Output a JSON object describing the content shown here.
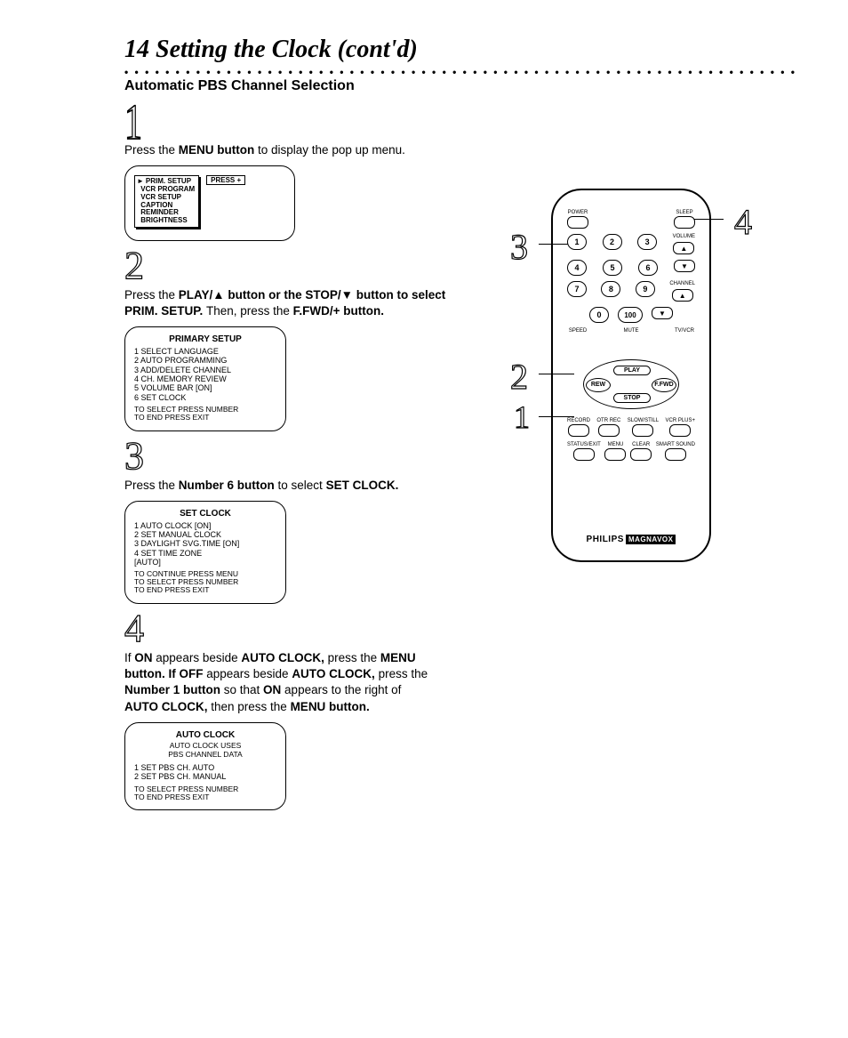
{
  "page": {
    "title": "14  Setting the Clock (cont'd)",
    "subtitle": "Automatic PBS Channel Selection"
  },
  "steps": {
    "s1": {
      "num": "1",
      "text_prefix": "Press the ",
      "bold1": "MENU button",
      "text_suffix": " to display the pop up menu."
    },
    "s2": {
      "num": "2",
      "line1_a": "Press the ",
      "line1_b": "PLAY/▲ button or the STOP/▼ button to select",
      "line2_a": "PRIM. SETUP. ",
      "line2_b": "Then, press the ",
      "line2_c": "F.FWD/+ button."
    },
    "s3": {
      "num": "3",
      "a": "Press the ",
      "b": "Number 6 button ",
      "c": "to select ",
      "d": "SET CLOCK."
    },
    "s4": {
      "num": "4",
      "l1a": "If ",
      "l1b": "ON ",
      "l1c": "appears beside ",
      "l1d": "AUTO CLOCK, ",
      "l1e": "press the ",
      "l1f": "MENU",
      "l2a": "button. If ",
      "l2b": "OFF ",
      "l2c": "appears beside ",
      "l2d": "AUTO CLOCK, ",
      "l2e": "press the",
      "l3a": "Number 1 button ",
      "l3b": "so that ",
      "l3c": "ON ",
      "l3d": "appears to the right of",
      "l4a": "AUTO CLOCK, ",
      "l4b": "then press the ",
      "l4c": "MENU button."
    }
  },
  "screens": {
    "menu1": {
      "items": [
        "PRIM. SETUP",
        "VCR PROGRAM",
        "VCR SETUP",
        "CAPTION",
        "REMINDER",
        "BRIGHTNESS"
      ],
      "button": "PRESS +"
    },
    "primary": {
      "heading": "PRIMARY SETUP",
      "items": [
        "1  SELECT LANGUAGE",
        "2  AUTO PROGRAMMING",
        "3  ADD/DELETE CHANNEL",
        "4  CH. MEMORY REVIEW",
        "5  VOLUME BAR        [ON]",
        "6  SET CLOCK"
      ],
      "foot1": "TO SELECT PRESS NUMBER",
      "foot2": "TO END PRESS EXIT"
    },
    "setclock": {
      "heading": "SET CLOCK",
      "items": [
        "1  AUTO CLOCK          [ON]",
        "2  SET MANUAL CLOCK",
        "3  DAYLIGHT SVG.TIME [ON]",
        "4  SET TIME ZONE",
        "    [AUTO]"
      ],
      "foot1": "TO CONTINUE PRESS MENU",
      "foot2": "TO SELECT PRESS NUMBER",
      "foot3": "TO END PRESS EXIT"
    },
    "autoclock": {
      "heading": "AUTO CLOCK",
      "sub1": "AUTO CLOCK USES",
      "sub2": "PBS CHANNEL DATA",
      "items": [
        "1    SET PBS CH.   AUTO",
        "2    SET PBS CH.   MANUAL"
      ],
      "foot1": "TO SELECT PRESS NUMBER",
      "foot2": "TO END PRESS EXIT"
    }
  },
  "remote": {
    "brand": "PHILIPS",
    "brand_sub": "MAGNAVOX",
    "labels": {
      "power": "POWER",
      "sleep": "SLEEP",
      "vol_up": "▲",
      "vol_dn": "▼",
      "ch_up": "▲",
      "ch_dn": "▼",
      "volume_lbl": "VOLUME",
      "channel_lbl": "CHANNEL",
      "speed": "SPEED",
      "mute": "MUTE",
      "tvvcr": "TV/VCR",
      "play": "PLAY",
      "stop": "STOP",
      "rew": "REW",
      "ffwd": "F.FWD",
      "record": "RECORD",
      "otrrec": "OTR REC",
      "slow": "SLOW/STILL",
      "vcrplus": "VCR PLUS+",
      "status": "STATUS/EXIT",
      "clear": "CLEAR",
      "menu": "MENU",
      "smart": "SMART SOUND"
    },
    "digits": [
      "1",
      "2",
      "3",
      "4",
      "5",
      "6",
      "7",
      "8",
      "9",
      "0",
      "100"
    ],
    "callouts": {
      "c1": "1",
      "c2": "2",
      "c3": "3",
      "c4": "4"
    }
  }
}
